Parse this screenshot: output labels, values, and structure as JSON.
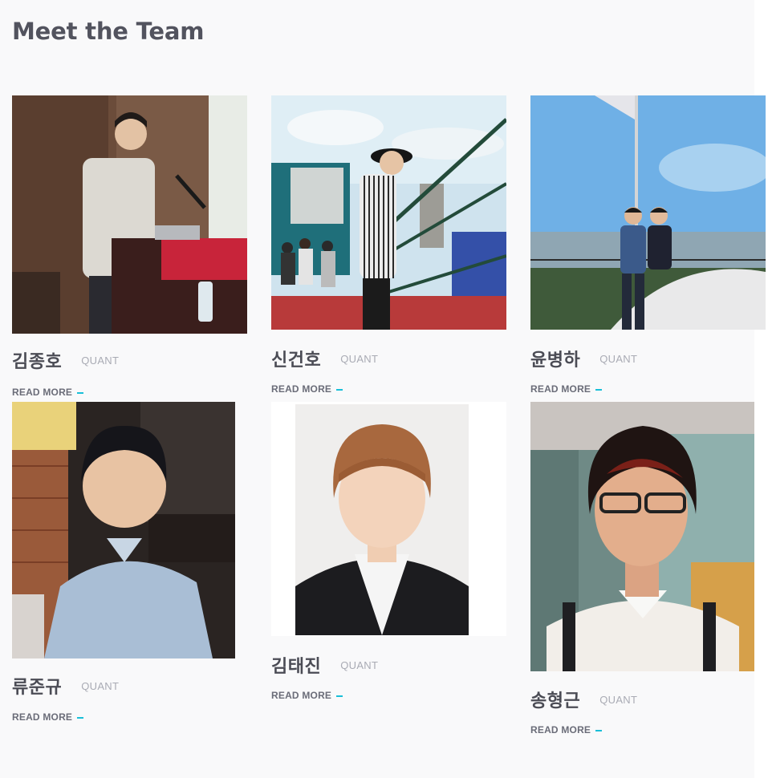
{
  "section": {
    "title": "Meet the Team"
  },
  "team": [
    {
      "name": "김종호",
      "role": "QUANT",
      "link": "READ MORE"
    },
    {
      "name": "신건호",
      "role": "QUANT",
      "link": "READ MORE"
    },
    {
      "name": "윤병하",
      "role": "QUANT",
      "link": "READ MORE"
    },
    {
      "name": "류준규",
      "role": "QUANT",
      "link": "READ MORE"
    },
    {
      "name": "김태진",
      "role": "QUANT",
      "link": "READ MORE"
    },
    {
      "name": "송형근",
      "role": "QUANT",
      "link": "READ MORE"
    }
  ],
  "colors": {
    "accent": "#19bfd8",
    "heading": "#52535e",
    "role": "#a9abb4",
    "background": "#f9f9fa"
  }
}
